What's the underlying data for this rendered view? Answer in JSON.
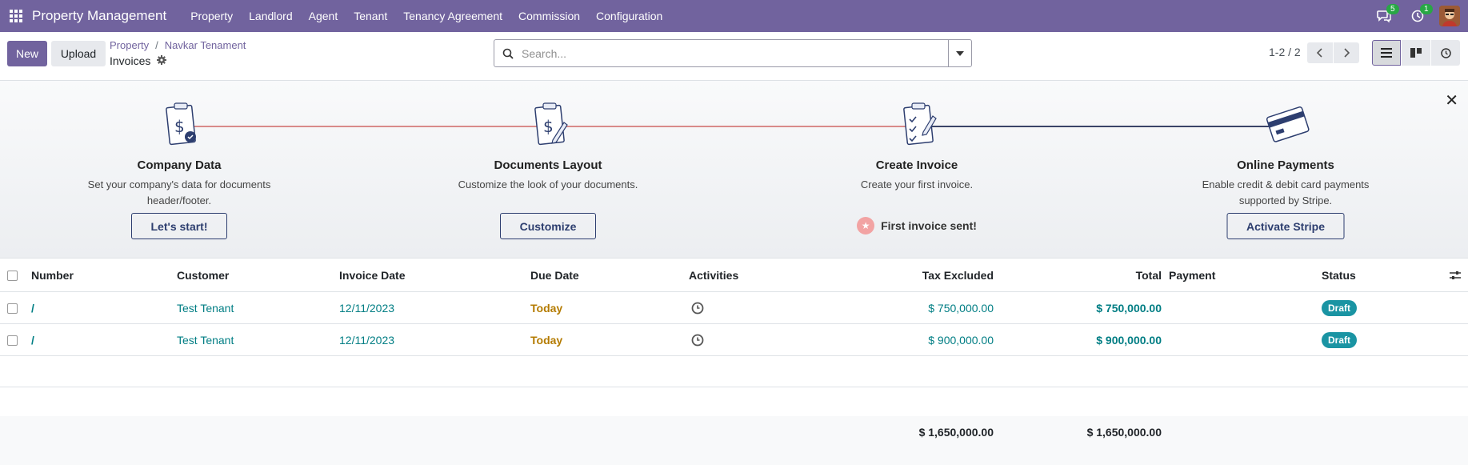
{
  "navbar": {
    "brand": "Property Management",
    "menu": [
      "Property",
      "Landlord",
      "Agent",
      "Tenant",
      "Tenancy Agreement",
      "Commission",
      "Configuration"
    ],
    "messages_count": "5",
    "activities_count": "1"
  },
  "control_panel": {
    "new_label": "New",
    "upload_label": "Upload",
    "breadcrumb": [
      "Property",
      "Navkar Tenament"
    ],
    "page_title": "Invoices",
    "search_placeholder": "Search...",
    "pager": "1-2 / 2"
  },
  "onboarding": {
    "steps": [
      {
        "title": "Company Data",
        "desc": "Set your company's data for documents header/footer.",
        "action": "Let's start!"
      },
      {
        "title": "Documents Layout",
        "desc": "Customize the look of your documents.",
        "action": "Customize"
      },
      {
        "title": "Create Invoice",
        "desc": "Create your first invoice.",
        "done": "First invoice sent!"
      },
      {
        "title": "Online Payments",
        "desc": "Enable credit & debit card payments supported by Stripe.",
        "action": "Activate Stripe"
      }
    ]
  },
  "table": {
    "columns": [
      "Number",
      "Customer",
      "Invoice Date",
      "Due Date",
      "Activities",
      "Tax Excluded",
      "Total",
      "Payment",
      "Status"
    ],
    "rows": [
      {
        "number": "/",
        "customer": "Test Tenant",
        "invoice_date": "12/11/2023",
        "due_date": "Today",
        "tax_excluded": "$ 750,000.00",
        "total": "$ 750,000.00",
        "status": "Draft"
      },
      {
        "number": "/",
        "customer": "Test Tenant",
        "invoice_date": "12/11/2023",
        "due_date": "Today",
        "tax_excluded": "$ 900,000.00",
        "total": "$ 900,000.00",
        "status": "Draft"
      }
    ],
    "totals": {
      "tax_excluded": "$ 1,650,000.00",
      "total": "$ 1,650,000.00"
    }
  },
  "colors": {
    "brand": "#71639e",
    "link": "#017e84",
    "today": "#b47b00",
    "draft_badge": "#1a94a3"
  }
}
